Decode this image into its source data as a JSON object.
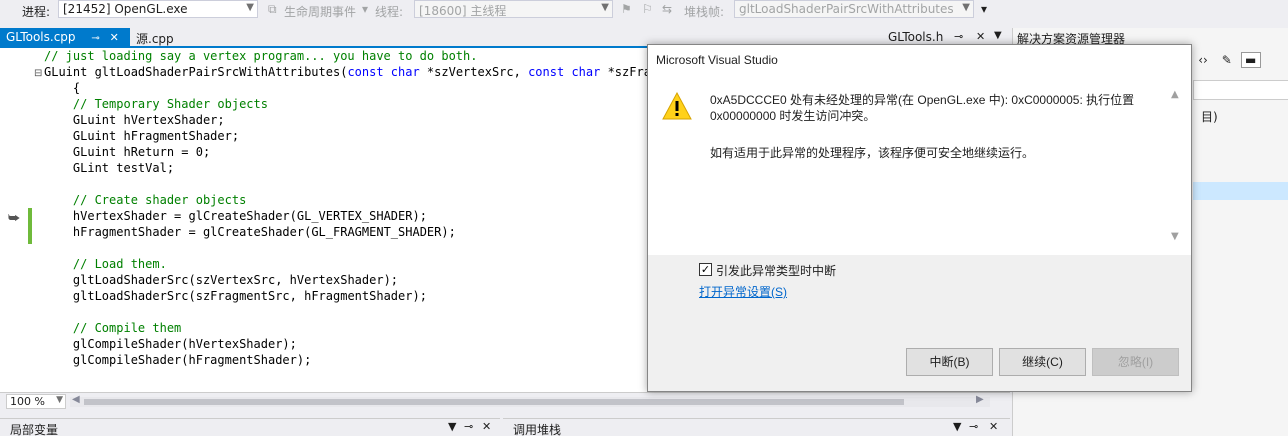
{
  "toolbar": {
    "process_label": "进程:",
    "process_value": "[21452] OpenGL.exe",
    "lifecycle_label": "生命周期事件",
    "thread_label": "线程:",
    "thread_value": "[18600] 主线程",
    "stack_label": "堆栈帧:",
    "stack_value": "gltLoadShaderPairSrcWithAttributes"
  },
  "tabs": [
    {
      "label": "GLTools.cpp",
      "active": true
    },
    {
      "label": "源.cpp",
      "active": false
    }
  ],
  "right_tab_label": "GLTools.h",
  "code_lines": [
    {
      "indent": "",
      "text": "// just loading say a vertex program... you have to do both.",
      "kind": "comment"
    },
    {
      "indent": "",
      "text": "GLuint gltLoadShaderPairSrcWithAttributes(const char *szVertexSrc, const char *szFragm",
      "kind": "code"
    },
    {
      "indent": "    ",
      "text": "{",
      "kind": "code"
    },
    {
      "indent": "    ",
      "text": "// Temporary Shader objects",
      "kind": "comment"
    },
    {
      "indent": "    ",
      "text": "GLuint hVertexShader;",
      "kind": "code"
    },
    {
      "indent": "    ",
      "text": "GLuint hFragmentShader;",
      "kind": "code"
    },
    {
      "indent": "    ",
      "text": "GLuint hReturn = 0;",
      "kind": "code"
    },
    {
      "indent": "    ",
      "text": "GLint testVal;",
      "kind": "code"
    },
    {
      "indent": "",
      "text": "",
      "kind": "code"
    },
    {
      "indent": "    ",
      "text": "// Create shader objects",
      "kind": "comment"
    },
    {
      "indent": "    ",
      "text": "hVertexShader = glCreateShader(GL_VERTEX_SHADER);",
      "kind": "code"
    },
    {
      "indent": "    ",
      "text": "hFragmentShader = glCreateShader(GL_FRAGMENT_SHADER);",
      "kind": "code"
    },
    {
      "indent": "",
      "text": "",
      "kind": "code"
    },
    {
      "indent": "    ",
      "text": "// Load them.",
      "kind": "comment"
    },
    {
      "indent": "    ",
      "text": "gltLoadShaderSrc(szVertexSrc, hVertexShader);",
      "kind": "code"
    },
    {
      "indent": "    ",
      "text": "gltLoadShaderSrc(szFragmentSrc, hFragmentShader);",
      "kind": "code"
    },
    {
      "indent": "",
      "text": "",
      "kind": "code"
    },
    {
      "indent": "    ",
      "text": "// Compile them",
      "kind": "comment"
    },
    {
      "indent": "    ",
      "text": "glCompileShader(hVertexShader);",
      "kind": "code"
    },
    {
      "indent": "    ",
      "text": "glCompileShader(hFragmentShader);",
      "kind": "code"
    }
  ],
  "zoom_value": "100 %",
  "bottom_panels": {
    "locals_title": "局部变量",
    "callstack_title": "调用堆栈"
  },
  "solution_explorer": {
    "title": "解决方案资源管理器",
    "fragment": "目)"
  },
  "dialog": {
    "title": "Microsoft Visual Studio",
    "message_line1": "0xA5DCCCE0 处有未经处理的异常(在 OpenGL.exe 中): 0xC0000005: 执行位置",
    "message_line2": "0x00000000 时发生访问冲突。",
    "message_hint": "如有适用于此异常的处理程序，该程序便可安全地继续运行。",
    "checkbox_label": "引发此异常类型时中断",
    "checkbox_checked": true,
    "link_label": "打开异常设置(S)",
    "break_button": "中断(B)",
    "continue_button": "继续(C)",
    "ignore_button": "忽略(I)"
  },
  "colors": {
    "accent": "#007acc",
    "comment": "#008000",
    "keyword": "#0000ff",
    "warning": "#ffd11a"
  }
}
